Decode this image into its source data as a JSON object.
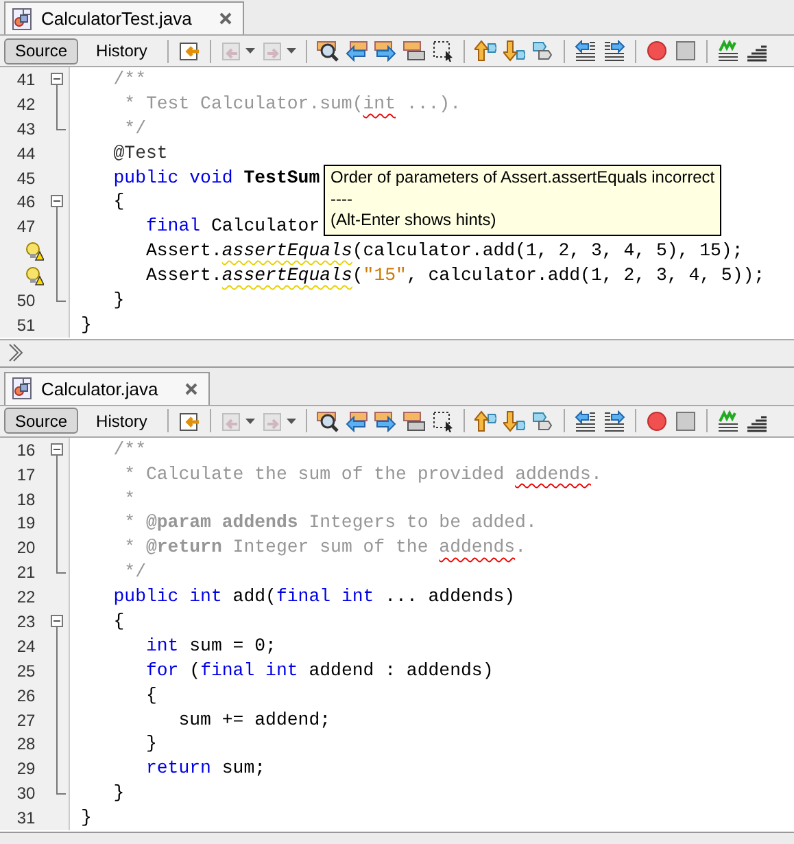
{
  "editors": [
    {
      "tab": {
        "title": "CalculatorTest.java",
        "selected": true
      },
      "view_buttons": [
        {
          "label": "Source",
          "selected": true
        },
        {
          "label": "History",
          "selected": false
        }
      ],
      "tool_groups": [
        [
          {
            "kind": "jump-back",
            "disabled": false
          }
        ],
        [
          {
            "kind": "back",
            "disabled": true,
            "dropdown": true
          },
          {
            "kind": "forward",
            "disabled": true,
            "dropdown": true
          }
        ],
        [
          {
            "kind": "find",
            "disabled": false
          },
          {
            "kind": "find-prev",
            "disabled": false
          },
          {
            "kind": "find-next",
            "disabled": false
          },
          {
            "kind": "highlight",
            "disabled": false
          },
          {
            "kind": "select-rect",
            "disabled": false
          }
        ],
        [
          {
            "kind": "bookmark-prev",
            "disabled": false
          },
          {
            "kind": "bookmark-next",
            "disabled": false
          },
          {
            "kind": "bookmark-toggle",
            "disabled": false
          }
        ],
        [
          {
            "kind": "shift-left",
            "disabled": false
          },
          {
            "kind": "shift-right",
            "disabled": false
          }
        ],
        [
          {
            "kind": "record",
            "disabled": false
          },
          {
            "kind": "stop",
            "disabled": false
          }
        ],
        [
          {
            "kind": "comment",
            "disabled": false
          },
          {
            "kind": "uncomment",
            "disabled": false
          }
        ]
      ],
      "lines": [
        {
          "number": "41",
          "fold_start": true,
          "fold_end": false,
          "hint": false,
          "tokens": [
            {
              "kind": "comment",
              "text": "   /**"
            }
          ]
        },
        {
          "number": "42",
          "fold_start": false,
          "fold_end": false,
          "hint": false,
          "tokens": [
            {
              "kind": "comment",
              "text": "    * Test Calculator.sum("
            },
            {
              "kind": "comment",
              "text": "int",
              "misspelled": true
            },
            {
              "kind": "comment",
              "text": " ...)."
            }
          ]
        },
        {
          "number": "43",
          "fold_start": false,
          "fold_end": true,
          "hint": false,
          "tokens": [
            {
              "kind": "comment",
              "text": "    */"
            }
          ]
        },
        {
          "number": "44",
          "fold_start": false,
          "fold_end": false,
          "hint": false,
          "tokens": [
            {
              "kind": "annotation",
              "text": "   @Test"
            }
          ]
        },
        {
          "number": "45",
          "fold_start": false,
          "fold_end": false,
          "hint": false,
          "tokens": [
            {
              "kind": "keyword",
              "text": "   public void "
            },
            {
              "kind": "bold",
              "text": "TestSum"
            }
          ]
        },
        {
          "number": "46",
          "fold_start": true,
          "fold_end": false,
          "hint": false,
          "tokens": [
            {
              "kind": "plain",
              "text": "   {"
            }
          ]
        },
        {
          "number": "47",
          "fold_start": false,
          "fold_end": false,
          "hint": false,
          "tokens": [
            {
              "kind": "keyword",
              "text": "      final"
            },
            {
              "kind": "plain",
              "text": " Calculator"
            }
          ]
        },
        {
          "fold_start": false,
          "fold_end": false,
          "hint": true,
          "tokens": [
            {
              "kind": "plain",
              "text": "      Assert."
            },
            {
              "kind": "italic",
              "text": "assertEquals",
              "warning": true
            },
            {
              "kind": "plain",
              "text": "(calculator.add(1, 2, 3, 4, 5), 15);"
            }
          ]
        },
        {
          "fold_start": false,
          "fold_end": false,
          "hint": true,
          "tokens": [
            {
              "kind": "plain",
              "text": "      Assert."
            },
            {
              "kind": "italic",
              "text": "assertEquals",
              "warning": true
            },
            {
              "kind": "plain",
              "text": "("
            },
            {
              "kind": "string",
              "text": "\"15\""
            },
            {
              "kind": "plain",
              "text": ", calculator.add(1, 2, 3, 4, 5));"
            }
          ]
        },
        {
          "number": "50",
          "fold_start": false,
          "fold_end": true,
          "hint": false,
          "tokens": [
            {
              "kind": "plain",
              "text": "   }"
            }
          ]
        },
        {
          "number": "51",
          "fold_start": false,
          "fold_end": false,
          "hint": false,
          "tokens": [
            {
              "kind": "plain",
              "text": "}"
            }
          ]
        }
      ],
      "tooltip": {
        "lines": [
          "Order of parameters of Assert.assertEquals incorrect",
          "----",
          "(Alt-Enter shows hints)"
        ]
      },
      "breadcrumbs": true
    },
    {
      "tab": {
        "title": "Calculator.java",
        "selected": true
      },
      "view_buttons": [
        {
          "label": "Source",
          "selected": true
        },
        {
          "label": "History",
          "selected": false
        }
      ],
      "tool_groups": [
        [
          {
            "kind": "jump-back",
            "disabled": false
          }
        ],
        [
          {
            "kind": "back",
            "disabled": true,
            "dropdown": true
          },
          {
            "kind": "forward",
            "disabled": true,
            "dropdown": true
          }
        ],
        [
          {
            "kind": "find",
            "disabled": false
          },
          {
            "kind": "find-prev",
            "disabled": false
          },
          {
            "kind": "find-next",
            "disabled": false
          },
          {
            "kind": "highlight",
            "disabled": false
          },
          {
            "kind": "select-rect",
            "disabled": false
          }
        ],
        [
          {
            "kind": "bookmark-prev",
            "disabled": false
          },
          {
            "kind": "bookmark-next",
            "disabled": false
          },
          {
            "kind": "bookmark-toggle",
            "disabled": false
          }
        ],
        [
          {
            "kind": "shift-left",
            "disabled": false
          },
          {
            "kind": "shift-right",
            "disabled": false
          }
        ],
        [
          {
            "kind": "record",
            "disabled": false
          },
          {
            "kind": "stop",
            "disabled": false
          }
        ],
        [
          {
            "kind": "comment",
            "disabled": false
          },
          {
            "kind": "uncomment",
            "disabled": false
          }
        ]
      ],
      "lines": [
        {
          "number": "16",
          "fold_start": true,
          "fold_end": false,
          "hint": false,
          "tokens": [
            {
              "kind": "comment",
              "text": "   /**"
            }
          ]
        },
        {
          "number": "17",
          "fold_start": false,
          "fold_end": false,
          "hint": false,
          "tokens": [
            {
              "kind": "comment",
              "text": "    * Calculate the sum of the provided "
            },
            {
              "kind": "comment",
              "text": "addends",
              "misspelled": true
            },
            {
              "kind": "comment",
              "text": "."
            }
          ]
        },
        {
          "number": "18",
          "fold_start": false,
          "fold_end": false,
          "hint": false,
          "tokens": [
            {
              "kind": "comment",
              "text": "    *"
            }
          ]
        },
        {
          "number": "19",
          "fold_start": false,
          "fold_end": false,
          "hint": false,
          "tokens": [
            {
              "kind": "comment",
              "text": "    * "
            },
            {
              "kind": "comment-tag",
              "text": "@param"
            },
            {
              "kind": "comment-bold",
              "text": " addends"
            },
            {
              "kind": "comment",
              "text": " Integers to be added."
            }
          ]
        },
        {
          "number": "20",
          "fold_start": false,
          "fold_end": false,
          "hint": false,
          "tokens": [
            {
              "kind": "comment",
              "text": "    * "
            },
            {
              "kind": "comment-tag",
              "text": "@return"
            },
            {
              "kind": "comment",
              "text": " Integer sum of the "
            },
            {
              "kind": "comment",
              "text": "addends",
              "misspelled": true
            },
            {
              "kind": "comment",
              "text": "."
            }
          ]
        },
        {
          "number": "21",
          "fold_start": false,
          "fold_end": true,
          "hint": false,
          "tokens": [
            {
              "kind": "comment",
              "text": "    */"
            }
          ]
        },
        {
          "number": "22",
          "fold_start": false,
          "fold_end": false,
          "hint": false,
          "tokens": [
            {
              "kind": "keyword",
              "text": "   public int"
            },
            {
              "kind": "plain",
              "text": " add("
            },
            {
              "kind": "keyword",
              "text": "final int"
            },
            {
              "kind": "plain",
              "text": " ... addends)"
            }
          ]
        },
        {
          "number": "23",
          "fold_start": true,
          "fold_end": false,
          "hint": false,
          "tokens": [
            {
              "kind": "plain",
              "text": "   {"
            }
          ]
        },
        {
          "number": "24",
          "fold_start": false,
          "fold_end": false,
          "hint": false,
          "tokens": [
            {
              "kind": "keyword",
              "text": "      int"
            },
            {
              "kind": "plain",
              "text": " sum = 0;"
            }
          ]
        },
        {
          "number": "25",
          "fold_start": false,
          "fold_end": false,
          "hint": false,
          "tokens": [
            {
              "kind": "keyword",
              "text": "      for"
            },
            {
              "kind": "plain",
              "text": " ("
            },
            {
              "kind": "keyword",
              "text": "final int"
            },
            {
              "kind": "plain",
              "text": " addend : addends)"
            }
          ]
        },
        {
          "number": "26",
          "fold_start": false,
          "fold_end": false,
          "hint": false,
          "tokens": [
            {
              "kind": "plain",
              "text": "      {"
            }
          ]
        },
        {
          "number": "27",
          "fold_start": false,
          "fold_end": false,
          "hint": false,
          "tokens": [
            {
              "kind": "plain",
              "text": "         sum += addend;"
            }
          ]
        },
        {
          "number": "28",
          "fold_start": false,
          "fold_end": false,
          "hint": false,
          "tokens": [
            {
              "kind": "plain",
              "text": "      }"
            }
          ]
        },
        {
          "number": "29",
          "fold_start": false,
          "fold_end": false,
          "hint": false,
          "tokens": [
            {
              "kind": "keyword",
              "text": "      return"
            },
            {
              "kind": "plain",
              "text": " sum;"
            }
          ]
        },
        {
          "number": "30",
          "fold_start": false,
          "fold_end": true,
          "hint": false,
          "tokens": [
            {
              "kind": "plain",
              "text": "   }"
            }
          ]
        },
        {
          "number": "31",
          "fold_start": false,
          "fold_end": false,
          "hint": false,
          "tokens": [
            {
              "kind": "plain",
              "text": "}"
            }
          ]
        }
      ]
    }
  ]
}
